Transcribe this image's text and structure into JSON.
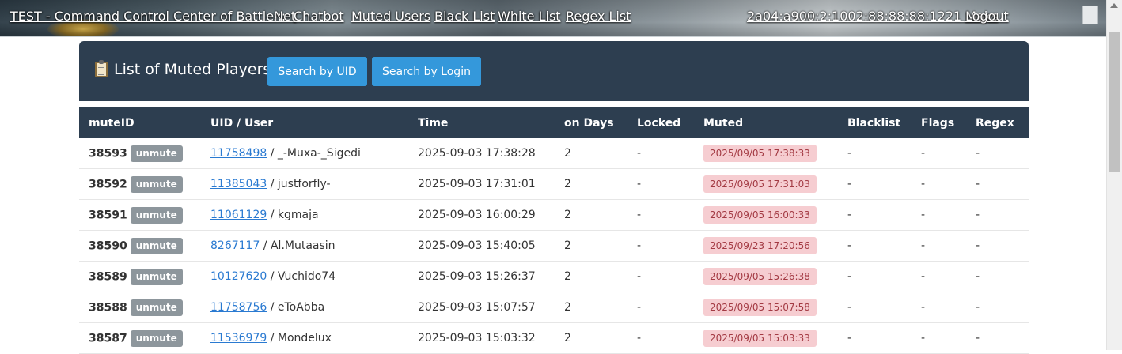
{
  "nav": {
    "title": "TEST - Command Control Center of BattleNet",
    "separator": ":::",
    "links": [
      "Chatbot",
      "Muted Users",
      "Black List",
      "White List",
      "Regex List"
    ],
    "user": "2a04:a900:2:1002:88:88:88:1221 Maks",
    "logout": "Logout"
  },
  "panel": {
    "title": "List of Muted Players",
    "icon": "clipboard-icon",
    "search_uid": "Search by UID",
    "search_login": "Search by Login"
  },
  "table": {
    "headers": [
      "muteID",
      "UID / User",
      "Time",
      "on Days",
      "Locked",
      "Muted",
      "Blacklist",
      "Flags",
      "Regex"
    ],
    "unmute_label": "unmute",
    "rows": [
      {
        "id": "38593",
        "uid": "11758498",
        "user": " / _-Muxa-_Sigedi",
        "time": "2025-09-03 17:38:28",
        "days": "2",
        "locked": "-",
        "muted": "2025/09/05 17:38:33",
        "blacklist": "-",
        "flags": "-",
        "regex": "-"
      },
      {
        "id": "38592",
        "uid": "11385043",
        "user": " / justforfly-",
        "time": "2025-09-03 17:31:01",
        "days": "2",
        "locked": "-",
        "muted": "2025/09/05 17:31:03",
        "blacklist": "-",
        "flags": "-",
        "regex": "-"
      },
      {
        "id": "38591",
        "uid": "11061129",
        "user": " / kgmaja",
        "time": "2025-09-03 16:00:29",
        "days": "2",
        "locked": "-",
        "muted": "2025/09/05 16:00:33",
        "blacklist": "-",
        "flags": "-",
        "regex": "-"
      },
      {
        "id": "38590",
        "uid": "8267117",
        "user": " / Al.Mutaasin",
        "time": "2025-09-03 15:40:05",
        "days": "2",
        "locked": "-",
        "muted": "2025/09/23 17:20:56",
        "blacklist": "-",
        "flags": "-",
        "regex": "-"
      },
      {
        "id": "38589",
        "uid": "10127620",
        "user": " / Vuchido74",
        "time": "2025-09-03 15:26:37",
        "days": "2",
        "locked": "-",
        "muted": "2025/09/05 15:26:38",
        "blacklist": "-",
        "flags": "-",
        "regex": "-"
      },
      {
        "id": "38588",
        "uid": "11758756",
        "user": " / eToAbba",
        "time": "2025-09-03 15:07:57",
        "days": "2",
        "locked": "-",
        "muted": "2025/09/05 15:07:58",
        "blacklist": "-",
        "flags": "-",
        "regex": "-"
      },
      {
        "id": "38587",
        "uid": "11536979",
        "user": " / Mondelux",
        "time": "2025-09-03 15:03:32",
        "days": "2",
        "locked": "-",
        "muted": "2025/09/05 15:03:33",
        "blacklist": "-",
        "flags": "-",
        "regex": "-"
      }
    ]
  }
}
